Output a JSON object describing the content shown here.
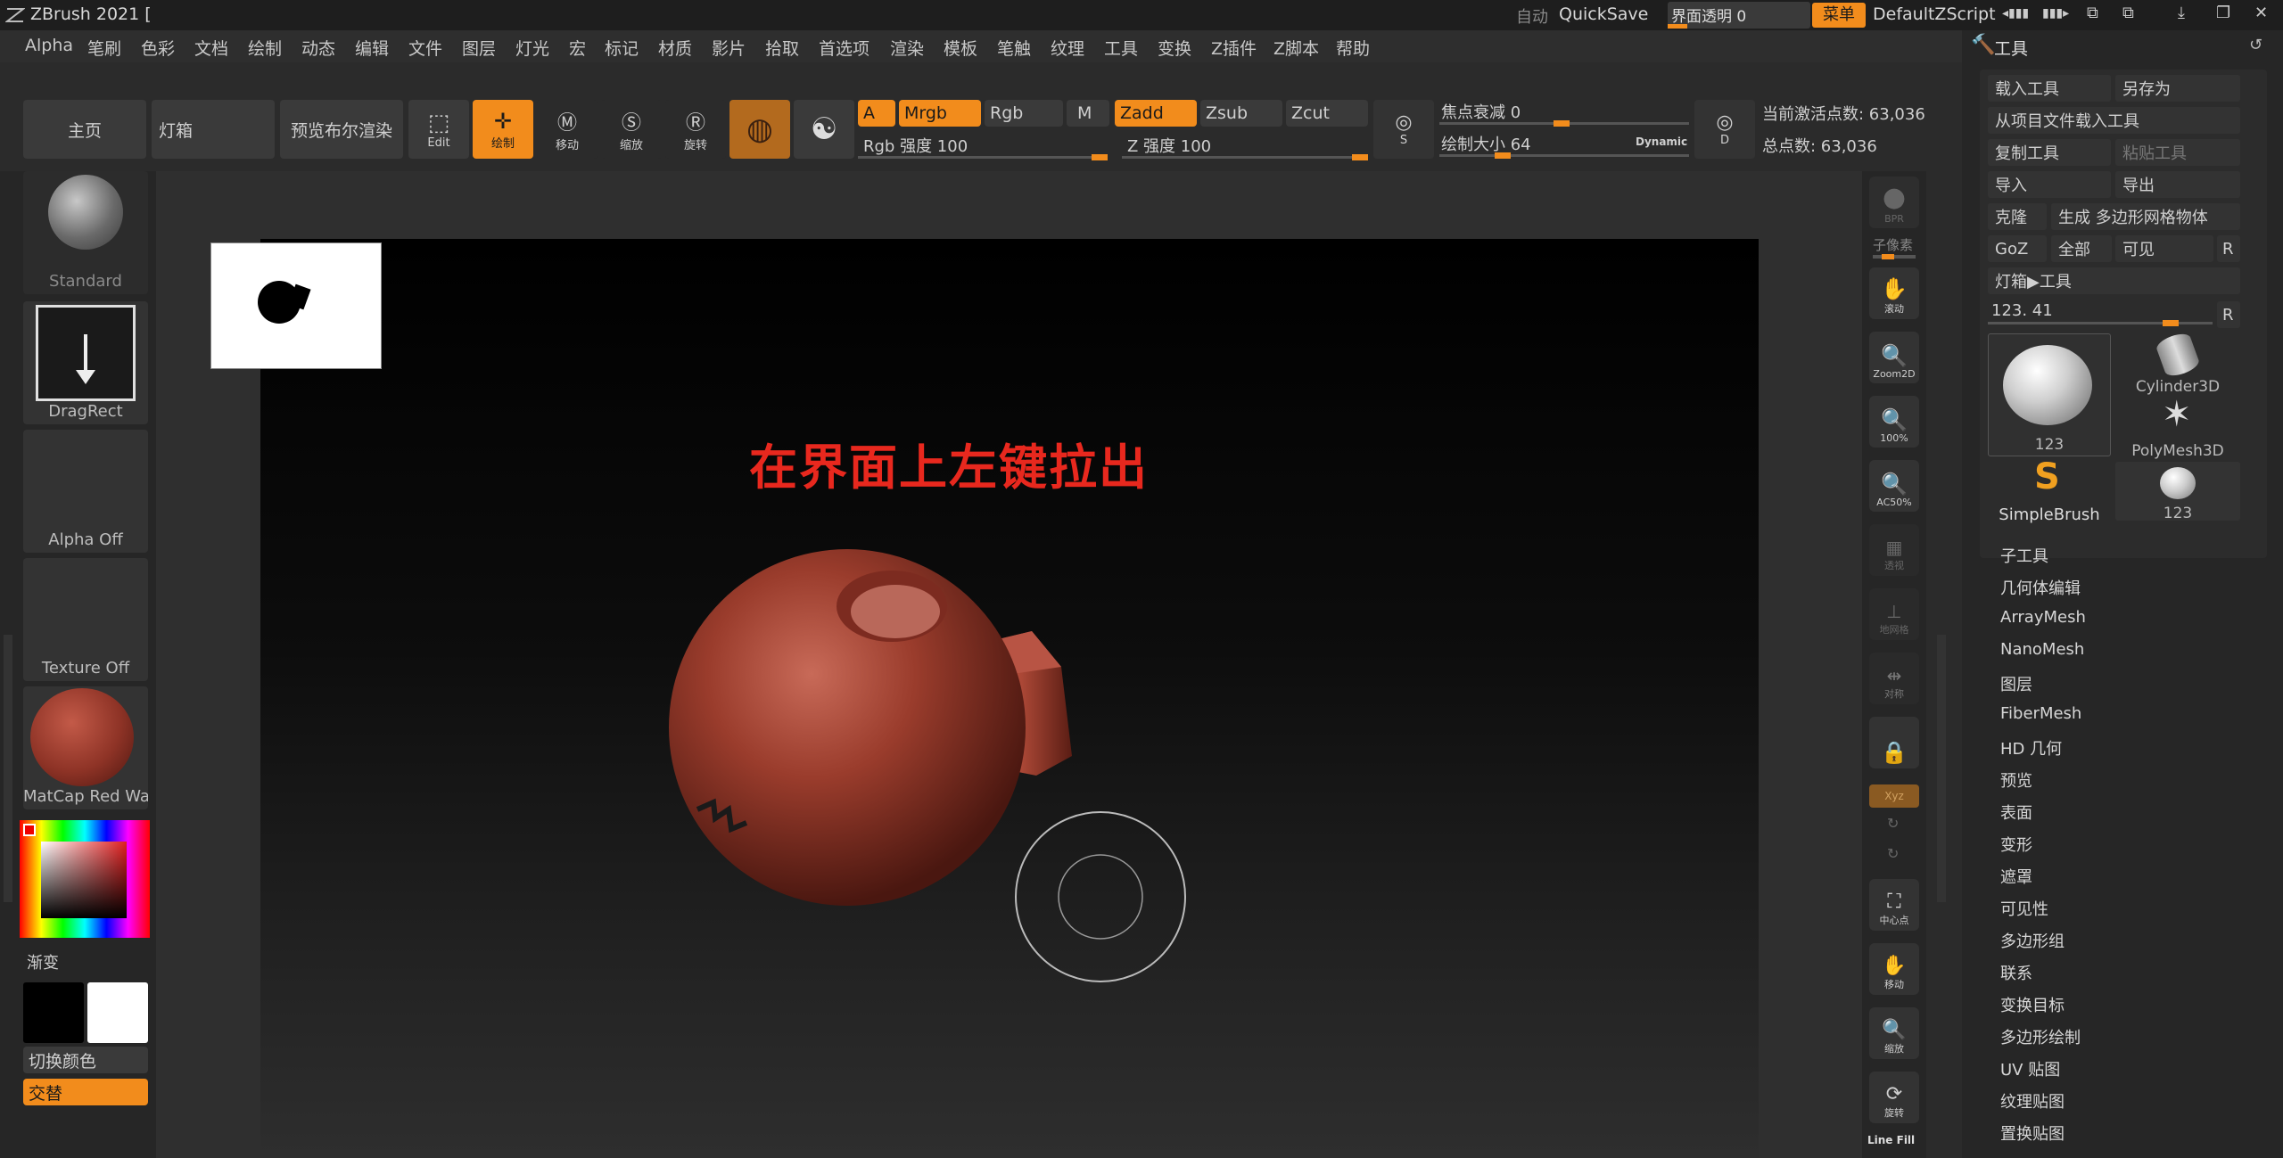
{
  "app": {
    "title": "ZBrush 2021 [",
    "auto_label": "自动",
    "quicksave": "QuickSave",
    "ui_transparency": "界面透明 0",
    "menu_button": "菜单",
    "default_script": "DefaultZScript"
  },
  "menubar": [
    "Alpha",
    "笔刷",
    "色彩",
    "文档",
    "绘制",
    "动态",
    "编辑",
    "文件",
    "图层",
    "灯光",
    "宏",
    "标记",
    "材质",
    "影片",
    "拾取",
    "首选项",
    "渲染",
    "模板",
    "笔触",
    "纹理",
    "工具",
    "变换",
    "Z插件",
    "Z脚本",
    "帮助"
  ],
  "toolbar": {
    "home": "主页",
    "lightbox": "灯箱",
    "bpr_preview": "预览布尔渲染",
    "edit": "Edit",
    "draw": "绘制",
    "move": "移动",
    "scale": "缩放",
    "rotate": "旋转",
    "a": "A",
    "mrgb": "Mrgb",
    "rgb": "Rgb",
    "m": "M",
    "zadd": "Zadd",
    "zsub": "Zsub",
    "zcut": "Zcut",
    "rgb_intensity": "Rgb 强度 100",
    "z_intensity": "Z 强度 100",
    "focal_shift": "焦点衰减 0",
    "draw_size": "绘制大小 64",
    "dynamic": "Dynamic",
    "active_points": "当前激活点数: 63,036",
    "total_points": "总点数: 63,036",
    "s_label": "S",
    "d_label": "D"
  },
  "leftpanel": {
    "brush": "Standard",
    "stroke": "DragRect",
    "alpha": "Alpha Off",
    "texture": "Texture Off",
    "material": "MatCap Red Wax",
    "gradient": "渐变",
    "switch_color": "切换颜色",
    "alternate": "交替"
  },
  "canvas": {
    "annotation": "在界面上左键拉出"
  },
  "rightbar": [
    "BPR",
    "子像素",
    "滚动",
    "Zoom2D",
    "100%",
    "AC50%",
    "透视",
    "地网格",
    "对称",
    "",
    "Xyz",
    "",
    "",
    "中心点",
    "移动",
    "缩放",
    "旋转",
    "Line Fill"
  ],
  "toolpanel": {
    "title": "工具",
    "load_tool": "载入工具",
    "save_as": "另存为",
    "load_from_project": "从项目文件载入工具",
    "copy_tool": "复制工具",
    "paste_tool": "粘贴工具",
    "import": "导入",
    "export": "导出",
    "clone": "克隆",
    "make_polymesh": "生成 多边形网格物体",
    "goz": "GoZ",
    "all": "全部",
    "visible": "可见",
    "r": "R",
    "lightbox_tool": "灯箱▶工具",
    "tool_value": "123. 41",
    "tools": [
      "123",
      "Cylinder3D",
      "PolyMesh3D",
      "SimpleBrush",
      "123"
    ],
    "subpalettes": [
      "子工具",
      "几何体编辑",
      "ArrayMesh",
      "NanoMesh",
      "图层",
      "FiberMesh",
      "HD 几何",
      "预览",
      "表面",
      "变形",
      "遮罩",
      "可见性",
      "多边形组",
      "联系",
      "变换目标",
      "多边形绘制",
      "UV 贴图",
      "纹理贴图",
      "置换贴图"
    ]
  },
  "colors": {
    "accent": "#f28c1c",
    "annotation": "#e8281e",
    "material": "#8e3326"
  }
}
